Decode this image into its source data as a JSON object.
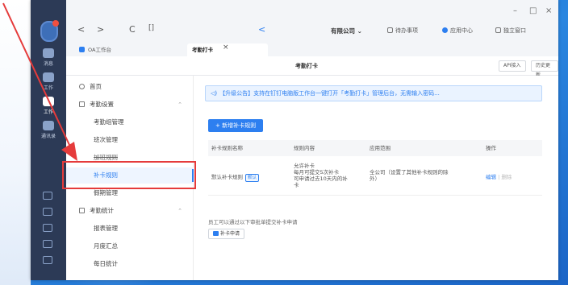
{
  "window": {
    "minimize": "–",
    "maximize": "□",
    "close": "×"
  },
  "rail": {
    "items": [
      {
        "label": "消息",
        "icon": "chat-icon"
      },
      {
        "label": "工作",
        "icon": "workbench-icon"
      },
      {
        "label": "通讯录",
        "icon": "contacts-icon"
      }
    ]
  },
  "toolbar": {
    "back": "<",
    "forward": ">",
    "refresh": "C",
    "fullscreen": "[]",
    "collapse": "<",
    "company": "有限公司 ⌄",
    "todo": "待办事项",
    "app_center": "应用中心",
    "standalone": "独立窗口"
  },
  "tabs": [
    {
      "label": "OA工作台"
    },
    {
      "label": "考勤打卡"
    }
  ],
  "header": {
    "title": "考勤打卡",
    "api_label": "API接入",
    "history_label": "历史更新"
  },
  "subnav": {
    "home": "首页",
    "settings": "考勤设置",
    "group_mgmt": "考勤组管理",
    "shift_mgmt": "班次管理",
    "overtime_rules": "加班规则",
    "makeup_rules": "补卡规则",
    "leave_mgmt": "假期管理",
    "stats": "考勤统计",
    "report_mgmt": "报表管理",
    "monthly_summary": "月度汇总",
    "daily_stats": "每日统计"
  },
  "main": {
    "notice": "【升级公告】支持在钉钉电脑版工作台一键打开「考勤打卡」管理后台，无需输入密码...",
    "add_button": "+ 新增补卡规则",
    "table": {
      "headers": [
        "补卡规则名称",
        "规则内容",
        "应用范围",
        "操作"
      ],
      "rows": [
        {
          "name": "默认补卡规则",
          "tag": "默认",
          "content": [
            "允许补卡",
            "每月可提交5次补卡",
            "可申请过去10天内的补",
            "卡"
          ],
          "scope": [
            "全公司（设置了其他补卡规则的除",
            "外）"
          ],
          "edit": "编辑",
          "delete": "删除"
        }
      ]
    },
    "footnote": "员工可以通过以下审批单提交补卡申请",
    "makeup_request": "补卡申请"
  }
}
